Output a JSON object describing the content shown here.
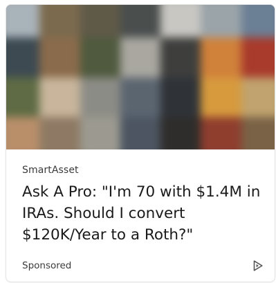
{
  "card": {
    "source": "SmartAsset",
    "headline": "Ask A Pro: \"I'm 70 with $1.4M in IRAs. Should I convert $120K/Year to a Roth?\"",
    "sponsored_label": "Sponsored",
    "adchoices_icon": "play-triangle-outline-icon"
  },
  "thumbnail": {
    "tile_colors": [
      "#a9b3ba",
      "#7b6a4e",
      "#5f5a48",
      "#4a4e4d",
      "#c9c7c2",
      "#9aa4a9",
      "#6b7f95",
      "#3d4a52",
      "#8a6b4b",
      "#4f5a3e",
      "#a9a7a0",
      "#3e3f3d",
      "#d0813a",
      "#a83b2c",
      "#5e6b44",
      "#c8b59b",
      "#8c8c86",
      "#5b6570",
      "#2f3338",
      "#d79a3d",
      "#c0a36e",
      "#b98f6a",
      "#8e7a64",
      "#9c9a90",
      "#4c5561",
      "#2e2d2b",
      "#8f3e2e",
      "#7a6246"
    ]
  }
}
